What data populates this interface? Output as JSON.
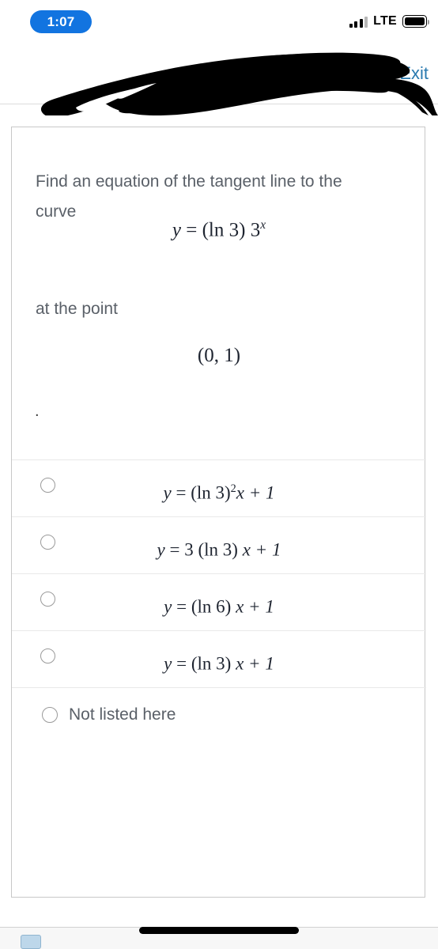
{
  "status_bar": {
    "time": "1:07",
    "carrier_tech": "LTE",
    "signal_icon": "signal-bars-icon",
    "battery_icon": "battery-full-icon",
    "time_pill_color": "#1274e0"
  },
  "header": {
    "exit_label": "Exit",
    "exit_color": "#2a7ab0",
    "redaction_icon": "black-scribble-redaction"
  },
  "question": {
    "prompt": "Find an equation of the tangent line to the curve",
    "equation": {
      "lhs": "y",
      "eq": "=",
      "rhs_base": "(ln 3) 3",
      "rhs_exponent": "x",
      "plain": "y = (ln 3) 3^x"
    },
    "at_point_label": "at the point",
    "point": "(0, 1)",
    "stray_mark": "."
  },
  "options": [
    {
      "id": "option-a",
      "radio_state": "unselected",
      "parts": {
        "lhs": "y",
        "eq": "=",
        "group": "(ln 3)",
        "exponent": "2",
        "tail": "x + 1"
      },
      "plain": "y = (ln 3)²x + 1"
    },
    {
      "id": "option-b",
      "radio_state": "unselected",
      "parts": {
        "lhs": "y",
        "eq": "=",
        "group": "3 (ln 3)",
        "exponent": "",
        "tail": "x + 1"
      },
      "plain": "y = 3 (ln 3) x + 1"
    },
    {
      "id": "option-c",
      "radio_state": "unselected",
      "parts": {
        "lhs": "y",
        "eq": "=",
        "group": "(ln 6)",
        "exponent": "",
        "tail": "x + 1"
      },
      "plain": "y = (ln 6) x + 1"
    },
    {
      "id": "option-d",
      "radio_state": "unselected",
      "parts": {
        "lhs": "y",
        "eq": "=",
        "group": "(ln 3)",
        "exponent": "",
        "tail": "x + 1"
      },
      "plain": "y = (ln 3) x + 1"
    }
  ],
  "not_listed_option": {
    "id": "option-not-listed",
    "label": "Not listed here",
    "radio_state": "unselected"
  },
  "bottom_bar": {
    "home_indicator": "home-indicator",
    "mini_icon": "page-thumbnail-icon"
  }
}
